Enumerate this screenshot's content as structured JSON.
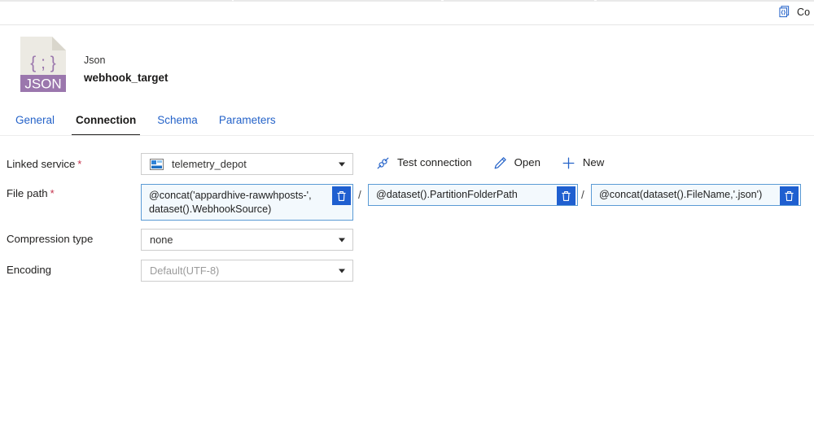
{
  "topbar": {
    "code_action": {
      "label": "Co",
      "icon": "code-brackets-icon"
    }
  },
  "dataset_header": {
    "icon_text": "JSON",
    "icon_glyph": "{ ; }",
    "type_label": "Json",
    "name": "webhook_target"
  },
  "tabs": [
    {
      "label": "General",
      "active": false
    },
    {
      "label": "Connection",
      "active": true
    },
    {
      "label": "Schema",
      "active": false
    },
    {
      "label": "Parameters",
      "active": false
    }
  ],
  "form": {
    "linked_service": {
      "label": "Linked service",
      "required": "*",
      "value": "telemetry_depot",
      "icon": "storage-account-icon"
    },
    "file_path": {
      "label": "File path",
      "required": "*",
      "segments": [
        {
          "value": "@concat('appardhive-rawwhposts-', dataset().WebhookSource)"
        },
        {
          "value": "@dataset().PartitionFolderPath"
        },
        {
          "value": "@concat(dataset().FileName,'.json')"
        }
      ],
      "separator": "/",
      "delete_tooltip": "Delete"
    },
    "compression_type": {
      "label": "Compression type",
      "value": "none"
    },
    "encoding": {
      "label": "Encoding",
      "value": "Default(UTF-8)"
    }
  },
  "actions": [
    {
      "label": "Test connection",
      "icon": "plug-icon"
    },
    {
      "label": "Open",
      "icon": "pencil-icon"
    },
    {
      "label": "New",
      "icon": "plus-icon"
    }
  ],
  "colors": {
    "accent_blue": "#2563c9",
    "button_blue": "#1f5fd0",
    "required_red": "#c4314b",
    "json_purple": "#9b77ad",
    "field_border_focus": "#5b9bd5"
  }
}
